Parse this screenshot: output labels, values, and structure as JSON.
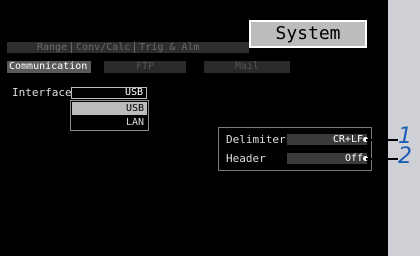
{
  "screen_title": "System",
  "top_tabs": [
    "Range",
    "Conv/Calc",
    "Trig & Alm"
  ],
  "sub_tabs": [
    "Communication",
    "FTP",
    "Mail"
  ],
  "interface": {
    "label": "Interface",
    "value": "USB",
    "options": [
      "USB",
      "LAN"
    ],
    "selected_option": "USB"
  },
  "settings": {
    "delimiter": {
      "label": "Delimiter",
      "value": "CR+LF"
    },
    "header": {
      "label": "Header",
      "value": "Off"
    }
  },
  "callouts": [
    "1",
    "2"
  ],
  "colors": {
    "screen_bg": "#000000",
    "selected_bg": "#bcbcbc",
    "callout_number": "#1a5fb4",
    "outer_bg": "#cfcfd6"
  }
}
